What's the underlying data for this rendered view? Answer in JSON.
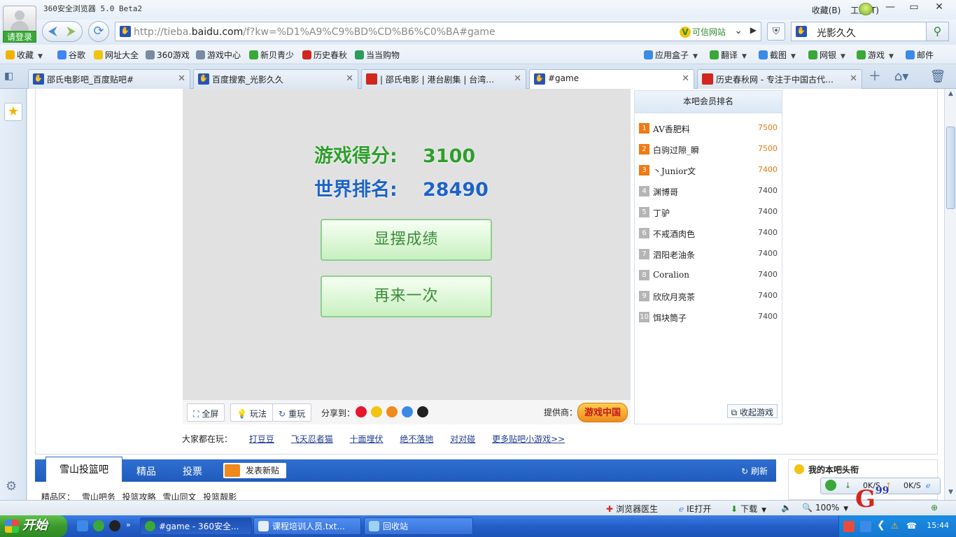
{
  "window": {
    "title": "360安全浏览器 5.0 Beta2",
    "menu": [
      "收藏(B)",
      "工具(T)"
    ],
    "login": "请登录",
    "controls": {
      "minimize": "—",
      "maximize": "▭",
      "close": "✕"
    }
  },
  "nav": {
    "url_prefix": "http://tieba.",
    "url_domain": "baidu.com",
    "url_rest": "/f?kw=%D1%A9%C9%BD%CD%B6%C0%BA#game",
    "trusted_label": "可信网站",
    "search_value": "光影久久"
  },
  "bookmarks": {
    "left": [
      {
        "label": "收藏",
        "color": "#f0b400",
        "caret": true
      },
      {
        "label": "谷歌",
        "color": "#4285f4"
      },
      {
        "label": "网址大全",
        "color": "#f1c40f"
      },
      {
        "label": "360游戏",
        "color": "#7a8aa0"
      },
      {
        "label": "游戏中心",
        "color": "#7a8aa0"
      },
      {
        "label": "新贝青少",
        "color": "#3aa838"
      },
      {
        "label": "历史春秋",
        "color": "#d0281e"
      },
      {
        "label": "当当购物",
        "color": "#2e9b5a"
      }
    ],
    "right": [
      {
        "label": "应用盒子",
        "color": "#3b8ae6"
      },
      {
        "label": "翻译",
        "color": "#3aa838"
      },
      {
        "label": "截图",
        "color": "#3b8ae6"
      },
      {
        "label": "网银",
        "color": "#3aa838"
      },
      {
        "label": "游戏",
        "color": "#3aa838"
      },
      {
        "label": "邮件",
        "color": "#3b8ae6"
      }
    ]
  },
  "tabs": [
    {
      "label": "邵氏电影吧_百度贴吧#",
      "icon_color": "#2454b7",
      "active": false
    },
    {
      "label": "百度搜索_光影久久",
      "icon_color": "#2454b7",
      "active": false
    },
    {
      "label": "| 邵氏电影 | 港台剧集 | 台湾…",
      "icon_color": "#d0281e",
      "active": false
    },
    {
      "label": "#game",
      "icon_color": "#2454b7",
      "active": true
    },
    {
      "label": "历史春秋网 - 专注于中国古代…",
      "icon_color": "#d0281e",
      "active": false
    }
  ],
  "game": {
    "score_label": "游戏得分:",
    "score_value": "3100",
    "rank_label": "世界排名:",
    "rank_value": "28490",
    "show_button": "显摆成绩",
    "again_button": "再来一次",
    "toolbar": {
      "fullscreen": "全屏",
      "howto": "玩法",
      "replay": "重玩",
      "share_label": "分享到：",
      "provider_label": "提供商：",
      "provider_logo": "游戏中国"
    }
  },
  "ranking": {
    "title": "本吧会员排名",
    "rows": [
      {
        "rank": "1",
        "name": "AV香肥料",
        "score": "7500"
      },
      {
        "rank": "2",
        "name": "白驹过隙_瞬",
        "score": "7500"
      },
      {
        "rank": "3",
        "name": "丶Junior文",
        "score": "7400"
      },
      {
        "rank": "4",
        "name": "渊博哥",
        "score": "7400"
      },
      {
        "rank": "5",
        "name": "丁驴",
        "score": "7400"
      },
      {
        "rank": "6",
        "name": "不戒酒肉色",
        "score": "7400"
      },
      {
        "rank": "7",
        "name": "泗阳老油条",
        "score": "7400"
      },
      {
        "rank": "8",
        "name": "Coralion",
        "score": "7400"
      },
      {
        "rank": "9",
        "name": "欣欣月亮茶",
        "score": "7400"
      },
      {
        "rank": "10",
        "name": "饵块筒子",
        "score": "7400"
      }
    ],
    "collapse": "收起游戏"
  },
  "popular": {
    "label": "大家都在玩：",
    "games": [
      "打豆豆",
      "飞天忍者猫",
      "十面埋伏",
      "绝不落地",
      "对对碰",
      "更多贴吧小游戏>>"
    ]
  },
  "forum": {
    "name": "雪山投篮吧",
    "tabs": [
      "精品",
      "投票"
    ],
    "new_post": "发表新贴",
    "refresh": "刷新",
    "sub_links": "精品区： 雪山吧务 投篮攻略 雪山同文 投篮靓影",
    "my_head": "我的本吧头衔"
  },
  "status": {
    "doctor": "浏览器医生",
    "ie": "IE打开",
    "download": "下载",
    "zoom": "100%",
    "down_speed": "0K/S",
    "up_speed": "0K/S"
  },
  "taskbar": {
    "start": "开始",
    "tasks": [
      {
        "label": "#game - 360安全...",
        "active": true
      },
      {
        "label": "课程培训人员.txt...",
        "active": false
      },
      {
        "label": "回收站",
        "active": false
      }
    ],
    "clock": "15:44"
  },
  "watermark": {
    "main": "G",
    "sup": "99"
  }
}
